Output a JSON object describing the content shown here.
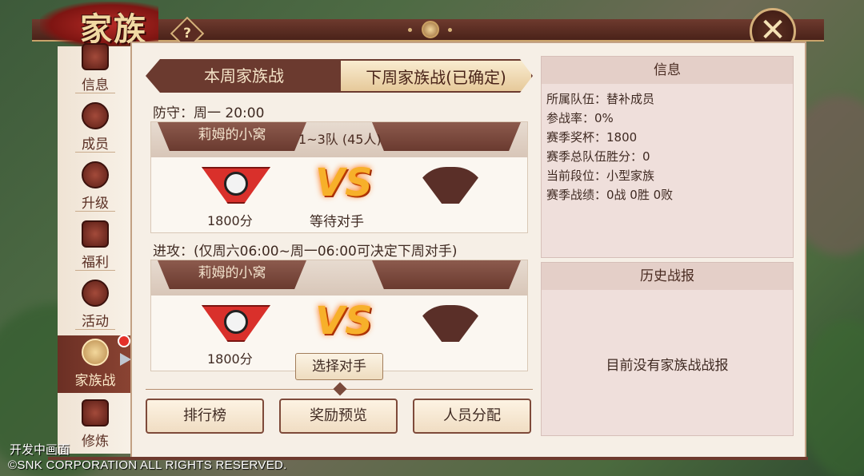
{
  "header": {
    "title": "家族",
    "help_label": "?",
    "close_label": "✕"
  },
  "sidebar": {
    "items": [
      {
        "label": "信息",
        "icon": "info-icon",
        "active": false
      },
      {
        "label": "成员",
        "icon": "members-icon",
        "active": false
      },
      {
        "label": "升级",
        "icon": "upgrade-icon",
        "active": false
      },
      {
        "label": "福利",
        "icon": "gift-icon",
        "active": false
      },
      {
        "label": "活动",
        "icon": "event-icon",
        "active": false
      },
      {
        "label": "家族战",
        "icon": "family-battle-icon",
        "active": true
      },
      {
        "label": "修炼",
        "icon": "training-icon",
        "active": false
      }
    ]
  },
  "tabs": [
    {
      "label": "本周家族战",
      "active": false
    },
    {
      "label": "下周家族战(已确定)",
      "active": true
    }
  ],
  "defense": {
    "heading": "防守：周一 20:00",
    "team_name": "莉姆的小窝",
    "team_count": "1~3队 (45人)",
    "vs": "VS",
    "score": "1800分",
    "status": "等待对手"
  },
  "attack": {
    "heading": "进攻：(仅周六06:00~周一06:00可决定下周对手)",
    "team_name": "莉姆的小窝",
    "vs": "VS",
    "score": "1800分",
    "choose_label": "选择对手"
  },
  "bottom_buttons": [
    {
      "label": "排行榜"
    },
    {
      "label": "奖励预览"
    },
    {
      "label": "人员分配"
    }
  ],
  "info": {
    "title": "信息",
    "lines": [
      "所属队伍：替补成员",
      "参战率：0%",
      "赛季奖杯：1800",
      "赛季总队伍胜分：0",
      "当前段位：小型家族",
      "赛季战绩：0战 0胜 0败"
    ]
  },
  "history": {
    "title": "历史战报",
    "empty_text": "目前没有家族战战报"
  },
  "footer": {
    "dev_label": "开发中画面",
    "copyright": "©SNK CORPORATION ALL RIGHTS RESERVED."
  },
  "colors": {
    "accent_dark": "#6b3a2f",
    "accent_red": "#d9302b",
    "panel_bg": "#f6efe6"
  }
}
